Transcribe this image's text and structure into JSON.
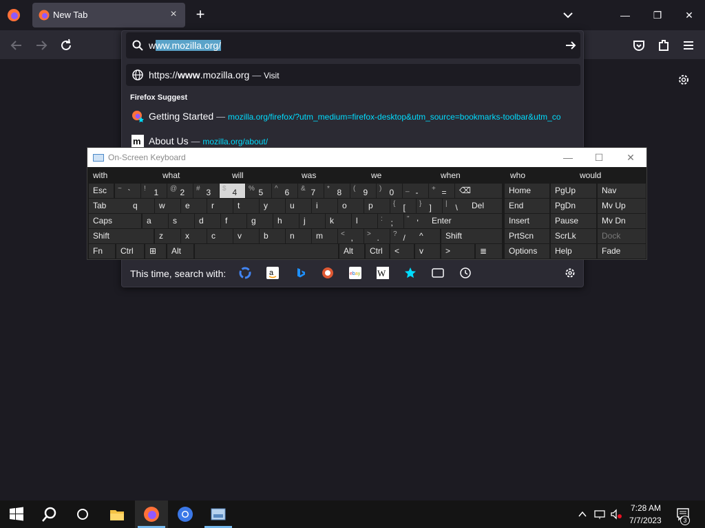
{
  "tab": {
    "title": "New Tab",
    "close": "×",
    "new": "+"
  },
  "window_controls": {
    "minimize": "—",
    "restore": "❐",
    "close": "✕"
  },
  "urlbar": {
    "value_prefix": "w",
    "value_selected": "ww.mozilla.org/"
  },
  "suggestions": {
    "visit": {
      "prefix": "https://",
      "bold": "www",
      "rest": ".mozilla.org",
      "sep": "—",
      "action": "Visit"
    },
    "header": "Firefox Suggest",
    "items": [
      {
        "title": "Getting Started",
        "sep": "—",
        "url": "mozilla.org/firefox/?utm_medium=firefox-desktop&utm_source=bookmarks-toolbar&utm_co"
      },
      {
        "title": "About Us",
        "sep": "—",
        "url": "mozilla.org/about/"
      }
    ],
    "search_with_label": "This time, search with:",
    "engines": [
      "google-icon",
      "amazon-icon",
      "bing-icon",
      "duckduckgo-icon",
      "ebay-icon",
      "wikipedia-icon",
      "bookmarks-star-icon",
      "tabs-icon",
      "history-icon"
    ]
  },
  "osk": {
    "title": "On-Screen Keyboard",
    "predictions": [
      "with",
      "what",
      "will",
      "was",
      "we",
      "when",
      "who",
      "would"
    ],
    "row1": [
      {
        "shift": "~",
        "main": "`"
      },
      {
        "shift": "!",
        "main": "1"
      },
      {
        "shift": "@",
        "main": "2"
      },
      {
        "shift": "#",
        "main": "3"
      },
      {
        "shift": "$",
        "main": "4"
      },
      {
        "shift": "%",
        "main": "5"
      },
      {
        "shift": "^",
        "main": "6"
      },
      {
        "shift": "&",
        "main": "7"
      },
      {
        "shift": "*",
        "main": "8"
      },
      {
        "shift": "(",
        "main": "9"
      },
      {
        "shift": ")",
        "main": "0"
      },
      {
        "shift": "_",
        "main": "-"
      },
      {
        "shift": "+",
        "main": "="
      }
    ],
    "labels": {
      "esc": "Esc",
      "tab": "Tab",
      "caps": "Caps",
      "shift": "Shift",
      "fn": "Fn",
      "ctrl": "Ctrl",
      "alt": "Alt",
      "del": "Del",
      "enter": "Enter",
      "home": "Home",
      "pgup": "PgUp",
      "nav": "Nav",
      "end": "End",
      "pgdn": "PgDn",
      "mvup": "Mv Up",
      "insert": "Insert",
      "pause": "Pause",
      "mvdn": "Mv Dn",
      "prtscn": "PrtScn",
      "scrlk": "ScrLk",
      "dock": "Dock",
      "options": "Options",
      "help": "Help",
      "fade": "Fade"
    },
    "row2": [
      "q",
      "w",
      "e",
      "r",
      "t",
      "y",
      "u",
      "i",
      "o",
      "p"
    ],
    "row2_sym": [
      {
        "shift": "{",
        "main": "["
      },
      {
        "shift": "}",
        "main": "]"
      },
      {
        "shift": "|",
        "main": "\\"
      }
    ],
    "row3": [
      "a",
      "s",
      "d",
      "f",
      "g",
      "h",
      "j",
      "k",
      "l"
    ],
    "row3_sym": [
      {
        "shift": ":",
        "main": ";"
      },
      {
        "shift": "\"",
        "main": "'"
      }
    ],
    "row4": [
      "z",
      "x",
      "c",
      "v",
      "b",
      "n",
      "m"
    ],
    "row4_sym": [
      {
        "shift": "<",
        "main": ","
      },
      {
        "shift": ">",
        "main": "."
      },
      {
        "shift": "?",
        "main": "/"
      }
    ],
    "arrows": {
      "up": "^",
      "left": "<",
      "down": "v",
      "right": ">"
    }
  },
  "clock": {
    "time": "7:28 AM",
    "date": "7/7/2023",
    "notifications": "3"
  }
}
